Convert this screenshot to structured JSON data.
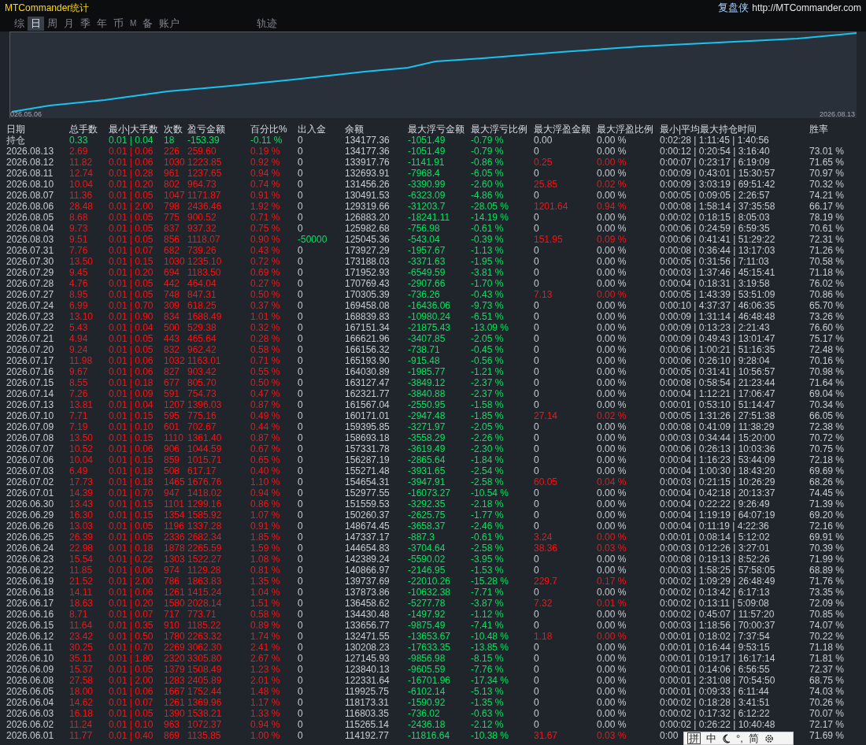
{
  "title": "MTCommander统计",
  "brand": {
    "name": "复盘侠",
    "url": "http://MTCommander.com"
  },
  "tabs": [
    {
      "label": "综",
      "selected": false
    },
    {
      "label": "日",
      "selected": true
    },
    {
      "label": "周",
      "selected": false
    },
    {
      "label": "月",
      "selected": false
    },
    {
      "label": "季",
      "selected": false
    },
    {
      "label": "年",
      "selected": false
    },
    {
      "label": "币",
      "selected": false
    },
    {
      "label": "M",
      "selected": false
    },
    {
      "label": "备",
      "selected": false
    },
    {
      "label": "账户",
      "selected": false
    },
    {
      "label": "轨迹",
      "selected": false
    }
  ],
  "chart": {
    "start_label": "026.05.06",
    "end_label": "2026.08.13"
  },
  "table": {
    "columns": [
      "日期",
      "总手数",
      "最小|大手数",
      "次数",
      "盈亏金额",
      "百分比%",
      "出入金",
      "余额",
      "最大浮亏金额",
      "最大浮亏比例",
      "最大浮盈金额",
      "最大浮盈比例",
      "最小|平均最大持仓时间",
      "胜率"
    ],
    "position_row": [
      "持仓",
      "0.33",
      "0.01 | 0.04",
      "18",
      "-153.39",
      "-0.11 %",
      "0",
      "134177.36",
      "-1051.49",
      "-0.79 %",
      "0.00",
      "0.00 %",
      "0:02:28 | 1:11:45 | 1:40:56"
    ],
    "rows": [
      {
        "cells": [
          "2026.08.13",
          "2.69",
          "0.01 | 0.06",
          "226",
          "259.60",
          "0.19 %",
          "0",
          "134177.36",
          "-1051.49",
          "-0.79 %",
          "0",
          "0.00 %",
          "0:00:12 | 0:20:54 | 3:16:40",
          "73.01 %"
        ],
        "floating_profit": false,
        "cash_flow": false
      },
      {
        "cells": [
          "2026.08.12",
          "11.82",
          "0.01 | 0.06",
          "1030",
          "1223.85",
          "0.92 %",
          "0",
          "133917.76",
          "-1141.91",
          "-0.86 %",
          "0.25",
          "0.00 %",
          "0:00:07 | 0:23:17 | 6:19:09",
          "71.65 %"
        ],
        "floating_profit": true,
        "cash_flow": false
      },
      {
        "cells": [
          "2026.08.11",
          "12.74",
          "0.01 | 0.28",
          "961",
          "1237.65",
          "0.94 %",
          "0",
          "132693.91",
          "-7968.4",
          "-6.05 %",
          "0",
          "0.00 %",
          "0:00:09 | 0:43:01 | 15:30:57",
          "70.97 %"
        ],
        "floating_profit": false,
        "cash_flow": false
      },
      {
        "cells": [
          "2026.08.10",
          "10.04",
          "0.01 | 0.20",
          "802",
          "964.73",
          "0.74 %",
          "0",
          "131456.26",
          "-3390.99",
          "-2.60 %",
          "25.85",
          "0.02 %",
          "0:00:09 | 3:03:19 | 69:51:42",
          "70.32 %"
        ],
        "floating_profit": true,
        "cash_flow": false
      },
      {
        "cells": [
          "2026.08.07",
          "11.36",
          "0.01 | 0.05",
          "1047",
          "1171.87",
          "0.91 %",
          "0",
          "130491.53",
          "-6323.09",
          "-4.86 %",
          "0",
          "0.00 %",
          "0:00:05 | 0:09:05 | 2:26:57",
          "74.21 %"
        ],
        "floating_profit": false,
        "cash_flow": false
      },
      {
        "cells": [
          "2026.08.06",
          "28.48",
          "0.01 | 2.00",
          "798",
          "2436.46",
          "1.92 %",
          "0",
          "129319.66",
          "-31203.7",
          "-28.05 %",
          "1201.64",
          "0.94 %",
          "0:00:08 | 1:58:14 | 37:35:58",
          "66.17 %"
        ],
        "floating_profit": true,
        "cash_flow": false
      },
      {
        "cells": [
          "2026.08.05",
          "8.68",
          "0.01 | 0.05",
          "775",
          "900.52",
          "0.71 %",
          "0",
          "126883.20",
          "-18241.11",
          "-14.19 %",
          "0",
          "0.00 %",
          "0:00:02 | 0:18:15 | 8:05:03",
          "78.19 %"
        ],
        "floating_profit": false,
        "cash_flow": false
      },
      {
        "cells": [
          "2026.08.04",
          "9.73",
          "0.01 | 0.05",
          "837",
          "937.32",
          "0.75 %",
          "0",
          "125982.68",
          "-756.98",
          "-0.61 %",
          "0",
          "0.00 %",
          "0:00:06 | 0:24:59 | 6:59:35",
          "70.61 %"
        ],
        "floating_profit": false,
        "cash_flow": false
      },
      {
        "cells": [
          "2026.08.03",
          "9.51",
          "0.01 | 0.05",
          "856",
          "1118.07",
          "0.90 %",
          "-50000",
          "125045.36",
          "-543.04",
          "-0.39 %",
          "151.95",
          "0.09 %",
          "0:00:06 | 0:41:41 | 51:29:22",
          "72.31 %"
        ],
        "floating_profit": true,
        "cash_flow": true
      },
      {
        "cells": [
          "2026.07.31",
          "7.76",
          "0.01 | 0.07",
          "682",
          "739.26",
          "0.43 %",
          "0",
          "173927.29",
          "-1957.67",
          "-1.13 %",
          "0",
          "0.00 %",
          "0:00:08 | 0:36:44 | 13:17:03",
          "71.26 %"
        ],
        "floating_profit": false,
        "cash_flow": false
      },
      {
        "cells": [
          "2026.07.30",
          "13.50",
          "0.01 | 0.15",
          "1030",
          "1235.10",
          "0.72 %",
          "0",
          "173188.03",
          "-3371.63",
          "-1.95 %",
          "0",
          "0.00 %",
          "0:00:05 | 0:31:56 | 7:11:03",
          "70.58 %"
        ],
        "floating_profit": false,
        "cash_flow": false
      },
      {
        "cells": [
          "2026.07.29",
          "9.45",
          "0.01 | 0.20",
          "694",
          "1183.50",
          "0.69 %",
          "0",
          "171952.93",
          "-6549.59",
          "-3.81 %",
          "0",
          "0.00 %",
          "0:00:03 | 1:37:46 | 45:15:41",
          "71.18 %"
        ],
        "floating_profit": false,
        "cash_flow": false
      },
      {
        "cells": [
          "2026.07.28",
          "4.76",
          "0.01 | 0.05",
          "442",
          "464.04",
          "0.27 %",
          "0",
          "170769.43",
          "-2907.66",
          "-1.70 %",
          "0",
          "0.00 %",
          "0:00:04 | 0:18:31 | 3:19:58",
          "76.02 %"
        ],
        "floating_profit": false,
        "cash_flow": false
      },
      {
        "cells": [
          "2026.07.27",
          "8.95",
          "0.01 | 0.05",
          "748",
          "847.31",
          "0.50 %",
          "0",
          "170305.39",
          "-736.26",
          "-0.43 %",
          "7.13",
          "0.00 %",
          "0:00:05 | 1:43:39 | 53:51:09",
          "70.86 %"
        ],
        "floating_profit": true,
        "cash_flow": false
      },
      {
        "cells": [
          "2026.07.24",
          "6.99",
          "0.01 | 0.70",
          "309",
          "618.25",
          "0.37 %",
          "0",
          "169458.08",
          "-16436.06",
          "-9.73 %",
          "0",
          "0.00 %",
          "0:00:10 | 4:37:37 | 46:06:35",
          "65.70 %"
        ],
        "floating_profit": false,
        "cash_flow": false
      },
      {
        "cells": [
          "2026.07.23",
          "13.10",
          "0.01 | 0.90",
          "834",
          "1688.49",
          "1.01 %",
          "0",
          "168839.83",
          "-10980.24",
          "-6.51 %",
          "0",
          "0.00 %",
          "0:00:09 | 1:31:14 | 46:48:48",
          "73.26 %"
        ],
        "floating_profit": false,
        "cash_flow": false
      },
      {
        "cells": [
          "2026.07.22",
          "5.43",
          "0.01 | 0.04",
          "500",
          "529.38",
          "0.32 %",
          "0",
          "167151.34",
          "-21875.43",
          "-13.09 %",
          "0",
          "0.00 %",
          "0:00:09 | 0:13:23 | 2:21:43",
          "76.60 %"
        ],
        "floating_profit": false,
        "cash_flow": false
      },
      {
        "cells": [
          "2026.07.21",
          "4.94",
          "0.01 | 0.05",
          "443",
          "465.64",
          "0.28 %",
          "0",
          "166621.96",
          "-3407.85",
          "-2.05 %",
          "0",
          "0.00 %",
          "0:00:09 | 0:49:43 | 13:01:47",
          "75.17 %"
        ],
        "floating_profit": false,
        "cash_flow": false
      },
      {
        "cells": [
          "2026.07.20",
          "9.24",
          "0.01 | 0.05",
          "832",
          "962.42",
          "0.58 %",
          "0",
          "166156.32",
          "-738.71",
          "-0.45 %",
          "0",
          "0.00 %",
          "0:00:06 | 1:00:21 | 51:16:35",
          "72.48 %"
        ],
        "floating_profit": false,
        "cash_flow": false
      },
      {
        "cells": [
          "2026.07.17",
          "11.98",
          "0.01 | 0.06",
          "1032",
          "1163.01",
          "0.71 %",
          "0",
          "165193.90",
          "-915.48",
          "-0.56 %",
          "0",
          "0.00 %",
          "0:00:06 | 0:26:10 | 9:28:04",
          "70.16 %"
        ],
        "floating_profit": false,
        "cash_flow": false
      },
      {
        "cells": [
          "2026.07.16",
          "9.67",
          "0.01 | 0.06",
          "827",
          "903.42",
          "0.55 %",
          "0",
          "164030.89",
          "-1985.77",
          "-1.21 %",
          "0",
          "0.00 %",
          "0:00:05 | 0:31:41 | 10:56:57",
          "70.98 %"
        ],
        "floating_profit": false,
        "cash_flow": false
      },
      {
        "cells": [
          "2026.07.15",
          "8.55",
          "0.01 | 0.18",
          "677",
          "805.70",
          "0.50 %",
          "0",
          "163127.47",
          "-3849.12",
          "-2.37 %",
          "0",
          "0.00 %",
          "0:00:08 | 0:58:54 | 21:23:44",
          "71.64 %"
        ],
        "floating_profit": false,
        "cash_flow": false
      },
      {
        "cells": [
          "2026.07.14",
          "7.26",
          "0.01 | 0.09",
          "591",
          "754.73",
          "0.47 %",
          "0",
          "162321.77",
          "-3840.88",
          "-2.37 %",
          "0",
          "0.00 %",
          "0:00:04 | 1:12:21 | 17:06:47",
          "69.04 %"
        ],
        "floating_profit": false,
        "cash_flow": false
      },
      {
        "cells": [
          "2026.07.13",
          "13.81",
          "0.01 | 0.04",
          "1207",
          "1396.03",
          "0.87 %",
          "0",
          "161567.04",
          "-2550.95",
          "-1.58 %",
          "0",
          "0.00 %",
          "0:00:01 | 0:53:10 | 51:14:47",
          "70.34 %"
        ],
        "floating_profit": false,
        "cash_flow": false
      },
      {
        "cells": [
          "2026.07.10",
          "7.71",
          "0.01 | 0.15",
          "595",
          "775.16",
          "0.49 %",
          "0",
          "160171.01",
          "-2947.48",
          "-1.85 %",
          "27.14",
          "0.02 %",
          "0:00:05 | 1:31:26 | 27:51:38",
          "66.05 %"
        ],
        "floating_profit": true,
        "cash_flow": false
      },
      {
        "cells": [
          "2026.07.09",
          "7.19",
          "0.01 | 0.10",
          "601",
          "702.67",
          "0.44 %",
          "0",
          "159395.85",
          "-3271.97",
          "-2.05 %",
          "0",
          "0.00 %",
          "0:00:08 | 0:41:09 | 11:38:29",
          "72.38 %"
        ],
        "floating_profit": false,
        "cash_flow": false
      },
      {
        "cells": [
          "2026.07.08",
          "13.50",
          "0.01 | 0.15",
          "1110",
          "1361.40",
          "0.87 %",
          "0",
          "158693.18",
          "-3558.29",
          "-2.26 %",
          "0",
          "0.00 %",
          "0:00:03 | 0:34:44 | 15:20:00",
          "70.72 %"
        ],
        "floating_profit": false,
        "cash_flow": false
      },
      {
        "cells": [
          "2026.07.07",
          "10.52",
          "0.01 | 0.06",
          "906",
          "1044.59",
          "0.67 %",
          "0",
          "157331.78",
          "-3619.49",
          "-2.30 %",
          "0",
          "0.00 %",
          "0:00:06 | 0:26:13 | 10:03:36",
          "70.75 %"
        ],
        "floating_profit": false,
        "cash_flow": false
      },
      {
        "cells": [
          "2026.07.06",
          "10.04",
          "0.01 | 0.15",
          "859",
          "1015.71",
          "0.65 %",
          "0",
          "156287.19",
          "-2865.64",
          "-1.84 %",
          "0",
          "0.00 %",
          "0:00:04 | 1:16:23 | 53:44:09",
          "72.18 %"
        ],
        "floating_profit": false,
        "cash_flow": false
      },
      {
        "cells": [
          "2026.07.03",
          "6.49",
          "0.01 | 0.18",
          "508",
          "617.17",
          "0.40 %",
          "0",
          "155271.48",
          "-3931.65",
          "-2.54 %",
          "0",
          "0.00 %",
          "0:00:04 | 1:00:30 | 18:43:20",
          "69.69 %"
        ],
        "floating_profit": false,
        "cash_flow": false
      },
      {
        "cells": [
          "2026.07.02",
          "17.73",
          "0.01 | 0.18",
          "1465",
          "1676.76",
          "1.10 %",
          "0",
          "154654.31",
          "-3947.91",
          "-2.58 %",
          "60.05",
          "0.04 %",
          "0:00:03 | 0:21:15 | 10:26:29",
          "68.26 %"
        ],
        "floating_profit": true,
        "cash_flow": false
      },
      {
        "cells": [
          "2026.07.01",
          "14.39",
          "0.01 | 0.70",
          "947",
          "1418.02",
          "0.94 %",
          "0",
          "152977.55",
          "-16073.27",
          "-10.54 %",
          "0",
          "0.00 %",
          "0:00:04 | 0:42:18 | 20:13:37",
          "74.45 %"
        ],
        "floating_profit": false,
        "cash_flow": false
      },
      {
        "cells": [
          "2026.06.30",
          "13.43",
          "0.01 | 0.15",
          "1101",
          "1299.16",
          "0.86 %",
          "0",
          "151559.53",
          "-3292.35",
          "-2.18 %",
          "0",
          "0.00 %",
          "0:00:04 | 0:22:22 | 9:26:49",
          "71.39 %"
        ],
        "floating_profit": false,
        "cash_flow": false
      },
      {
        "cells": [
          "2026.06.29",
          "16.30",
          "0.01 | 0.15",
          "1354",
          "1585.92",
          "1.07 %",
          "0",
          "150260.37",
          "-2625.75",
          "-1.77 %",
          "0",
          "0.00 %",
          "0:00:04 | 1:19:19 | 64:07:19",
          "69.20 %"
        ],
        "floating_profit": false,
        "cash_flow": false
      },
      {
        "cells": [
          "2026.06.26",
          "13.03",
          "0.01 | 0.05",
          "1196",
          "1337.28",
          "0.91 %",
          "0",
          "148674.45",
          "-3658.37",
          "-2.46 %",
          "0",
          "0.00 %",
          "0:00:04 | 0:11:19 | 4:22:36",
          "72.16 %"
        ],
        "floating_profit": false,
        "cash_flow": false
      },
      {
        "cells": [
          "2026.06.25",
          "26.39",
          "0.01 | 0.05",
          "2336",
          "2682.34",
          "1.85 %",
          "0",
          "147337.17",
          "-887.3",
          "-0.61 %",
          "3.24",
          "0.00 %",
          "0:00:01 | 0:08:14 | 5:12:02",
          "69.91 %"
        ],
        "floating_profit": true,
        "cash_flow": false
      },
      {
        "cells": [
          "2026.06.24",
          "22.98",
          "0.01 | 0.18",
          "1878",
          "2265.59",
          "1.59 %",
          "0",
          "144654.83",
          "-3704.64",
          "-2.58 %",
          "38.36",
          "0.03 %",
          "0:00:03 | 0:12:26 | 3:27:01",
          "70.39 %"
        ],
        "floating_profit": true,
        "cash_flow": false
      },
      {
        "cells": [
          "2026.06.23",
          "15.54",
          "0.01 | 0.22",
          "1303",
          "1522.27",
          "1.08 %",
          "0",
          "142389.24",
          "-5590.02",
          "-3.95 %",
          "0",
          "0.00 %",
          "0:00:08 | 0:19:13 | 8:52:26",
          "71.99 %"
        ],
        "floating_profit": false,
        "cash_flow": false
      },
      {
        "cells": [
          "2026.06.22",
          "11.85",
          "0.01 | 0.06",
          "974",
          "1129.28",
          "0.81 %",
          "0",
          "140866.97",
          "-2146.95",
          "-1.53 %",
          "0",
          "0.00 %",
          "0:00:03 | 1:58:25 | 57:58:05",
          "68.89 %"
        ],
        "floating_profit": false,
        "cash_flow": false
      },
      {
        "cells": [
          "2026.06.19",
          "21.52",
          "0.01 | 2.00",
          "786",
          "1863.83",
          "1.35 %",
          "0",
          "139737.69",
          "-22010.26",
          "-15.28 %",
          "229.7",
          "0.17 %",
          "0:00:02 | 1:09:29 | 26:48:49",
          "71.76 %"
        ],
        "floating_profit": true,
        "cash_flow": false
      },
      {
        "cells": [
          "2026.06.18",
          "14.11",
          "0.01 | 0.06",
          "1261",
          "1415.24",
          "1.04 %",
          "0",
          "137873.86",
          "-10632.38",
          "-7.71 %",
          "0",
          "0.00 %",
          "0:00:02 | 0:13:42 | 6:17:13",
          "73.35 %"
        ],
        "floating_profit": false,
        "cash_flow": false
      },
      {
        "cells": [
          "2026.06.17",
          "18.63",
          "0.01 | 0.20",
          "1580",
          "2028.14",
          "1.51 %",
          "0",
          "136458.62",
          "-5277.78",
          "-3.87 %",
          "7.32",
          "0.01 %",
          "0:00:02 | 0:13:11 | 5:09:08",
          "72.09 %"
        ],
        "floating_profit": true,
        "cash_flow": false
      },
      {
        "cells": [
          "2026.06.16",
          "8.71",
          "0.01 | 0.07",
          "717",
          "773.71",
          "0.58 %",
          "0",
          "134430.48",
          "-1497.92",
          "-1.12 %",
          "0",
          "0.00 %",
          "0:00:02 | 0:45:07 | 11:57:20",
          "70.85 %"
        ],
        "floating_profit": false,
        "cash_flow": false
      },
      {
        "cells": [
          "2026.06.15",
          "11.64",
          "0.01 | 0.35",
          "910",
          "1185.22",
          "0.89 %",
          "0",
          "133656.77",
          "-9875.49",
          "-7.41 %",
          "0",
          "0.00 %",
          "0:00:03 | 1:18:56 | 70:00:37",
          "74.07 %"
        ],
        "floating_profit": false,
        "cash_flow": false
      },
      {
        "cells": [
          "2026.06.12",
          "23.42",
          "0.01 | 0.50",
          "1780",
          "2263.32",
          "1.74 %",
          "0",
          "132471.55",
          "-13653.67",
          "-10.48 %",
          "1.18",
          "0.00 %",
          "0:00:01 | 0:18:02 | 7:37:54",
          "70.22 %"
        ],
        "floating_profit": true,
        "cash_flow": false
      },
      {
        "cells": [
          "2026.06.11",
          "30.25",
          "0.01 | 0.70",
          "2269",
          "3062.30",
          "2.41 %",
          "0",
          "130208.23",
          "-17633.35",
          "-13.85 %",
          "0",
          "0.00 %",
          "0:00:01 | 0:16:44 | 9:53:15",
          "71.18 %"
        ],
        "floating_profit": false,
        "cash_flow": false
      },
      {
        "cells": [
          "2026.06.10",
          "35.11",
          "0.01 | 1.80",
          "2320",
          "3305.80",
          "2.67 %",
          "0",
          "127145.93",
          "-9856.98",
          "-8.15 %",
          "0",
          "0.00 %",
          "0:00:01 | 0:19:17 | 16:17:14",
          "71.81 %"
        ],
        "floating_profit": false,
        "cash_flow": false
      },
      {
        "cells": [
          "2026.06.09",
          "15.37",
          "0.01 | 0.05",
          "1379",
          "1508.49",
          "1.23 %",
          "0",
          "123840.13",
          "-9605.59",
          "-7.76 %",
          "0",
          "0.00 %",
          "0:00:01 | 0:14:06 | 6:56:55",
          "72.37 %"
        ],
        "floating_profit": false,
        "cash_flow": false
      },
      {
        "cells": [
          "2026.06.08",
          "27.58",
          "0.01 | 2.00",
          "1283",
          "2405.89",
          "2.01 %",
          "0",
          "122331.64",
          "-16701.96",
          "-17.34 %",
          "0",
          "0.00 %",
          "0:00:01 | 2:31:08 | 70:54:50",
          "68.75 %"
        ],
        "floating_profit": false,
        "cash_flow": false
      },
      {
        "cells": [
          "2026.06.05",
          "18.00",
          "0.01 | 0.06",
          "1667",
          "1752.44",
          "1.48 %",
          "0",
          "119925.75",
          "-6102.14",
          "-5.13 %",
          "0",
          "0.00 %",
          "0:00:01 | 0:09:33 | 6:11:44",
          "74.03 %"
        ],
        "floating_profit": false,
        "cash_flow": false
      },
      {
        "cells": [
          "2026.06.04",
          "14.62",
          "0.01 | 0.07",
          "1261",
          "1369.96",
          "1.17 %",
          "0",
          "118173.31",
          "-1590.92",
          "-1.35 %",
          "0",
          "0.00 %",
          "0:00:02 | 0:18:28 | 3:41:51",
          "70.26 %"
        ],
        "floating_profit": false,
        "cash_flow": false
      },
      {
        "cells": [
          "2026.06.03",
          "16.18",
          "0.01 | 0.05",
          "1390",
          "1538.21",
          "1.33 %",
          "0",
          "116803.35",
          "-736.02",
          "-0.63 %",
          "0",
          "0.00 %",
          "0:00:02 | 0:17:32 | 6:12:22",
          "70.07 %"
        ],
        "floating_profit": false,
        "cash_flow": false
      },
      {
        "cells": [
          "2026.06.02",
          "11.24",
          "0.01 | 0.10",
          "963",
          "1072.37",
          "0.94 %",
          "0",
          "115265.14",
          "-2436.18",
          "-2.12 %",
          "0",
          "0.00 %",
          "0:00:02 | 0:26:22 | 10:40:48",
          "72.17 %"
        ],
        "floating_profit": false,
        "cash_flow": false
      },
      {
        "cells": [
          "2026.06.01",
          "11.77",
          "0.01 | 0.40",
          "869",
          "1135.85",
          "1.00 %",
          "0",
          "114192.77",
          "-11816.64",
          "-10.38 %",
          "31.67",
          "0.03 %",
          "0:00",
          "71.69 %"
        ],
        "floating_profit": true,
        "cash_flow": false
      }
    ]
  },
  "ime_toolbar": {
    "items": [
      "拼",
      "中",
      "°,",
      "简"
    ]
  }
}
